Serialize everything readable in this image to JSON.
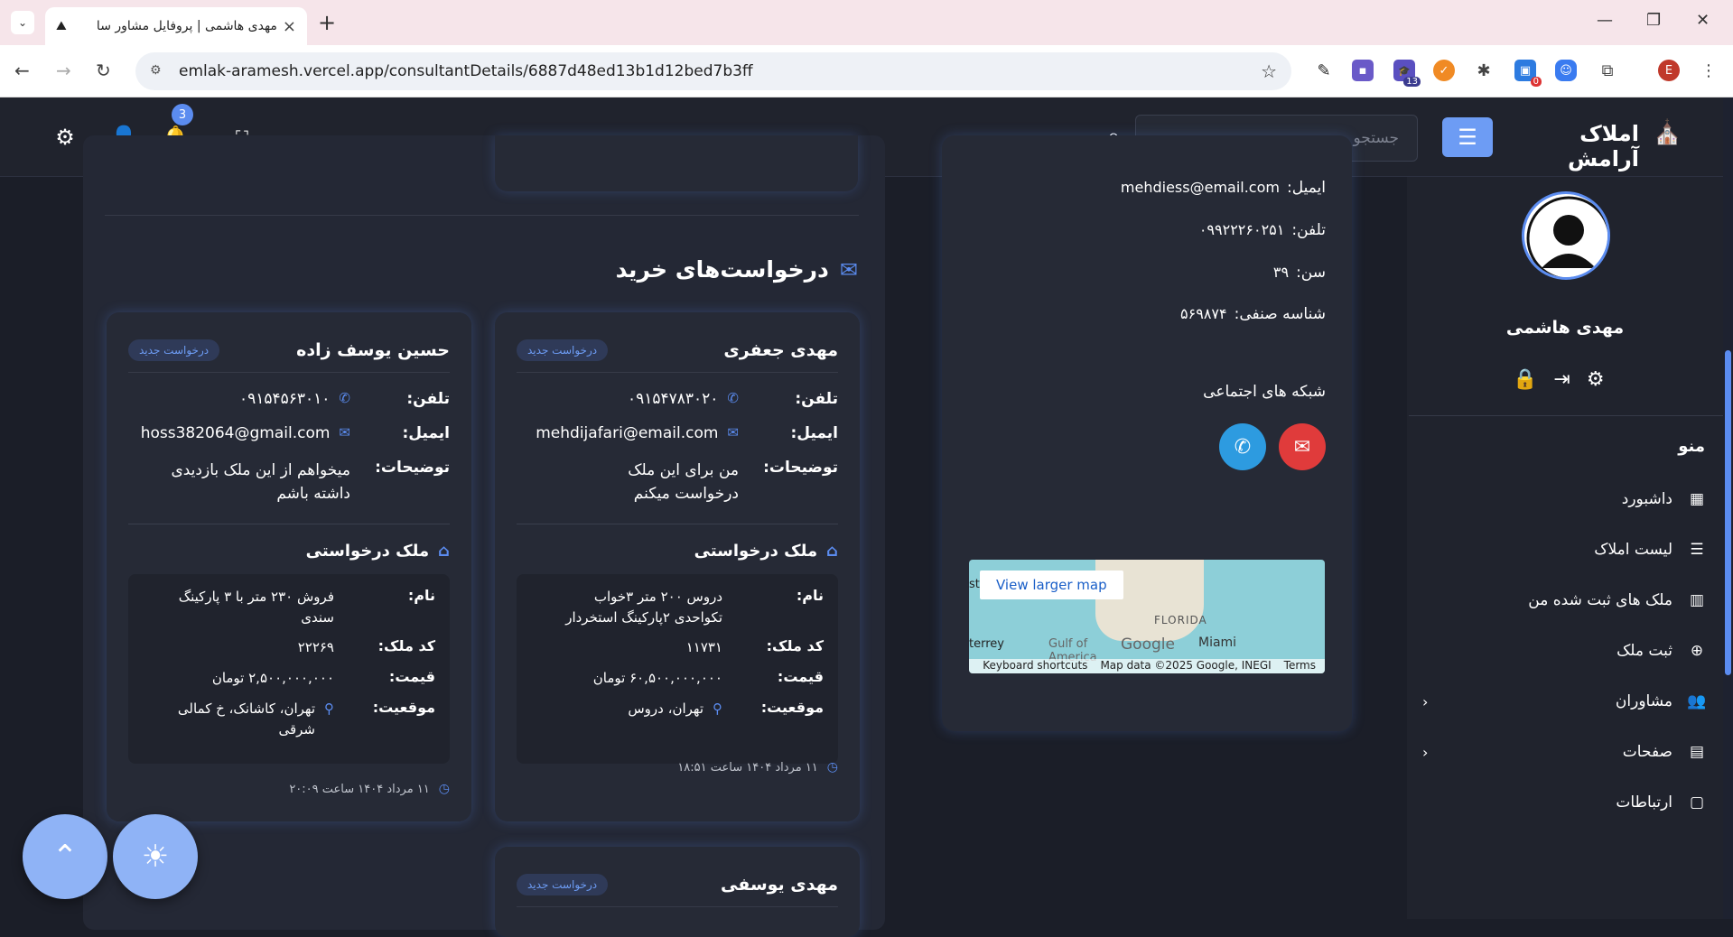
{
  "browser": {
    "tab_title": "مهدی هاشمی | پروفایل مشاور سا",
    "url": "emlak-aramesh.vercel.app/consultantDetails/6887d48ed13b1d12bed7b3ff",
    "ext_badge_13": "13",
    "ext_badge_0": "0",
    "profile_letter": "E"
  },
  "header": {
    "brand": "املاک آرامش",
    "search_placeholder": "جستجو",
    "notification_count": "3"
  },
  "sidebar": {
    "user_name": "مهدی هاشمی",
    "menu_title": "منو",
    "items": [
      {
        "label": "داشبورد",
        "icon": "dashboard-icon"
      },
      {
        "label": "لیست املاک",
        "icon": "list-icon"
      },
      {
        "label": "ملک های ثبت شده من",
        "icon": "building-icon"
      },
      {
        "label": "ثبت ملک",
        "icon": "plus-circle-icon"
      },
      {
        "label": "مشاوران",
        "icon": "users-icon"
      },
      {
        "label": "صفحات",
        "icon": "pages-icon"
      },
      {
        "label": "ارتباطات",
        "icon": "chat-icon"
      }
    ]
  },
  "contact": {
    "email_label": "ایمیل:",
    "email": "mehdiess@email.com",
    "phone_label": "تلفن:",
    "phone": "۰۹۹۲۲۲۶۰۲۵۱",
    "age_label": "سن:",
    "age": "۳۹",
    "guild_label": "شناسه صنفی:",
    "guild": "۵۶۹۸۷۴",
    "social_label": "شبکه های اجتماعی",
    "map": {
      "view_larger": "View larger map",
      "florida": "FLORIDA",
      "miami": "Miami",
      "gulf": "Gulf of",
      "america": "America",
      "monterrey": "terrey",
      "keyboard": "Keyboard shortcuts",
      "mapdata": "Map data ©2025 Google, INEGI",
      "terms": "Terms",
      "google": "Google",
      "st": "st"
    }
  },
  "requests": {
    "title": "درخواست‌های خرید",
    "labels": {
      "phone": "تلفن:",
      "email": "ایمیل:",
      "desc": "توضیحات:",
      "property": "ملک درخواستی",
      "name": "نام:",
      "code": "کد ملک:",
      "price": "قیمت:",
      "location": "موقعیت:"
    },
    "cards": [
      {
        "name": "مهدی جعفری",
        "badge": "درخواست جدید",
        "phone": "۰۹۱۵۴۷۸۳۰۲۰",
        "email": "mehdijafari@email.com",
        "desc": "من برای این ملک درخواست میکنم",
        "prop_name": "دروس ۲۰۰ متر ۳خواب تکواحدی ۲پارکینگ استخردار",
        "prop_code": "۱۱۷۳۱",
        "price": "۶۰,۵۰۰,۰۰۰,۰۰۰ تومان",
        "location": "تهران، دروس",
        "date": "۱۱ مرداد ۱۴۰۴ ساعت ۱۸:۵۱"
      },
      {
        "name": "حسین یوسف زاده",
        "badge": "درخواست جدید",
        "phone": "۰۹۱۵۴۵۶۳۰۱۰",
        "email": "hoss382064@gmail.com",
        "desc": "میخواهم از این ملک بازدیدی داشته باشم",
        "prop_name": "فروش ۲۳۰ متر با ۳ پارکینگ سندی",
        "prop_code": "۲۲۲۶۹",
        "price": "۲,۵۰۰,۰۰۰,۰۰۰ تومان",
        "location": "تهران، کاشانک، خ کمالی شرقی",
        "date": "۱۱ مرداد ۱۴۰۴ ساعت ۲۰:۰۹"
      },
      {
        "name": "مهدی یوسفی",
        "badge": "درخواست جدید"
      }
    ]
  }
}
